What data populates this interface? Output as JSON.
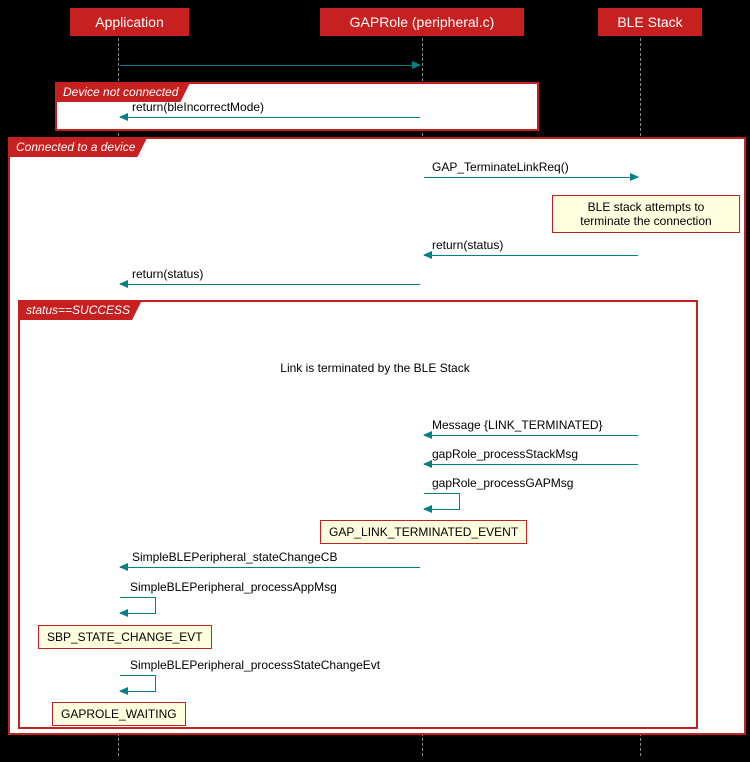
{
  "participants": {
    "app": "Application",
    "gaprole": "GAPRole (peripheral.c)",
    "ble": "BLE Stack"
  },
  "groups": {
    "not_connected": "Device not connected",
    "connected": "Connected to a device",
    "success": "status==SUCCESS"
  },
  "messages": {
    "return_incorrect": "return(bleIncorrectMode)",
    "terminate_link": "GAP_TerminateLinkReq()",
    "return_status1": "return(status)",
    "return_status2": "return(status)",
    "link_terminated_msg": "Message {LINK_TERMINATED}",
    "process_stack": "gapRole_processStackMsg",
    "process_gap": "gapRole_processGAPMsg",
    "state_change_cb": "SimpleBLEPeripheral_stateChangeCB",
    "process_app": "SimpleBLEPeripheral_processAppMsg",
    "process_state": "SimpleBLEPeripheral_processStateChangeEvt"
  },
  "notes": {
    "ble_attempts": "BLE stack attempts to\nterminate the connection",
    "link_term_event": "GAP_LINK_TERMINATED_EVENT",
    "sbp_state": "SBP_STATE_CHANGE_EVT",
    "gaprole_waiting": "GAPROLE_WAITING"
  },
  "center_text": "Link is terminated by the BLE Stack"
}
